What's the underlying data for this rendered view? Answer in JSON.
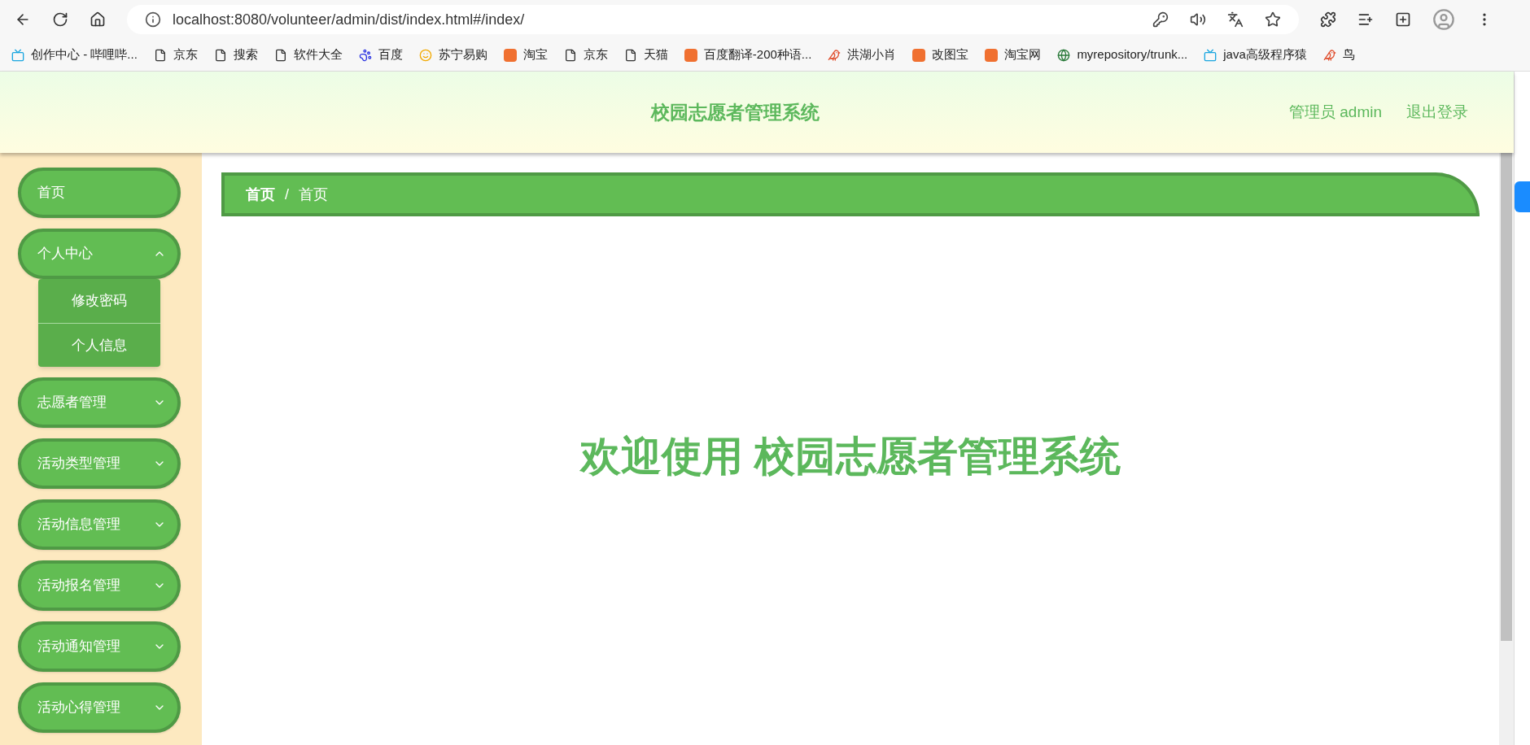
{
  "browser": {
    "url": "localhost:8080/volunteer/admin/dist/index.html#/index/"
  },
  "bookmarks": [
    {
      "kind": "tv",
      "label": "创作中心 - 哔哩哔..."
    },
    {
      "kind": "file",
      "label": "京东"
    },
    {
      "kind": "file",
      "label": "搜索"
    },
    {
      "kind": "file",
      "label": "软件大全"
    },
    {
      "kind": "paw",
      "label": "百度"
    },
    {
      "kind": "face",
      "label": "苏宁易购"
    },
    {
      "kind": "square",
      "label": "淘宝"
    },
    {
      "kind": "file",
      "label": "京东"
    },
    {
      "kind": "file",
      "label": "天猫"
    },
    {
      "kind": "square",
      "label": "百度翻译-200种语..."
    },
    {
      "kind": "bird",
      "label": "洪湖小肖"
    },
    {
      "kind": "square",
      "label": "改图宝"
    },
    {
      "kind": "square",
      "label": "淘宝网"
    },
    {
      "kind": "globe",
      "label": "myrepository/trunk..."
    },
    {
      "kind": "tv",
      "label": "java高级程序猿"
    },
    {
      "kind": "bird",
      "label": "鸟"
    }
  ],
  "header": {
    "title": "校园志愿者管理系统",
    "user": "管理员 admin",
    "logout": "退出登录"
  },
  "sidebar": {
    "items": [
      {
        "kind": "link",
        "label": "首页"
      },
      {
        "kind": "menu",
        "label": "个人中心",
        "expanded": true,
        "children": [
          {
            "label": "修改密码"
          },
          {
            "label": "个人信息"
          }
        ]
      },
      {
        "kind": "menu",
        "label": "志愿者管理",
        "expanded": false
      },
      {
        "kind": "menu",
        "label": "活动类型管理",
        "expanded": false
      },
      {
        "kind": "menu",
        "label": "活动信息管理",
        "expanded": false
      },
      {
        "kind": "menu",
        "label": "活动报名管理",
        "expanded": false
      },
      {
        "kind": "menu",
        "label": "活动通知管理",
        "expanded": false
      },
      {
        "kind": "menu",
        "label": "活动心得管理",
        "expanded": false
      }
    ]
  },
  "breadcrumb": [
    "首页",
    "首页"
  ],
  "breadcrumb_separator": "/",
  "welcome": "欢迎使用 校园志愿者管理系统"
}
